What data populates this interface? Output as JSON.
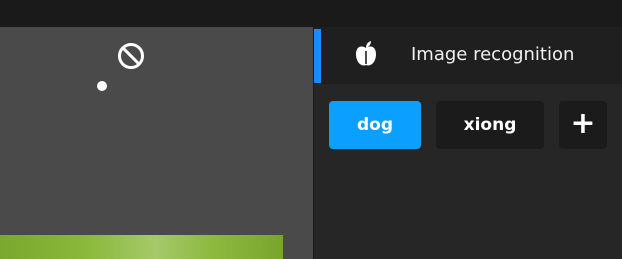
{
  "canvas": {
    "no_entry_icon": "no-entry-icon",
    "background_color": "#4a4a4a"
  },
  "panel": {
    "header": {
      "icon": "apple-icon",
      "title": "Image recognition",
      "active_color": "#1a8cff"
    },
    "tags": [
      {
        "label": "dog",
        "selected": true
      },
      {
        "label": "xiong",
        "selected": false
      }
    ],
    "add_label": "+",
    "accent_color": "#0ba0ff"
  }
}
